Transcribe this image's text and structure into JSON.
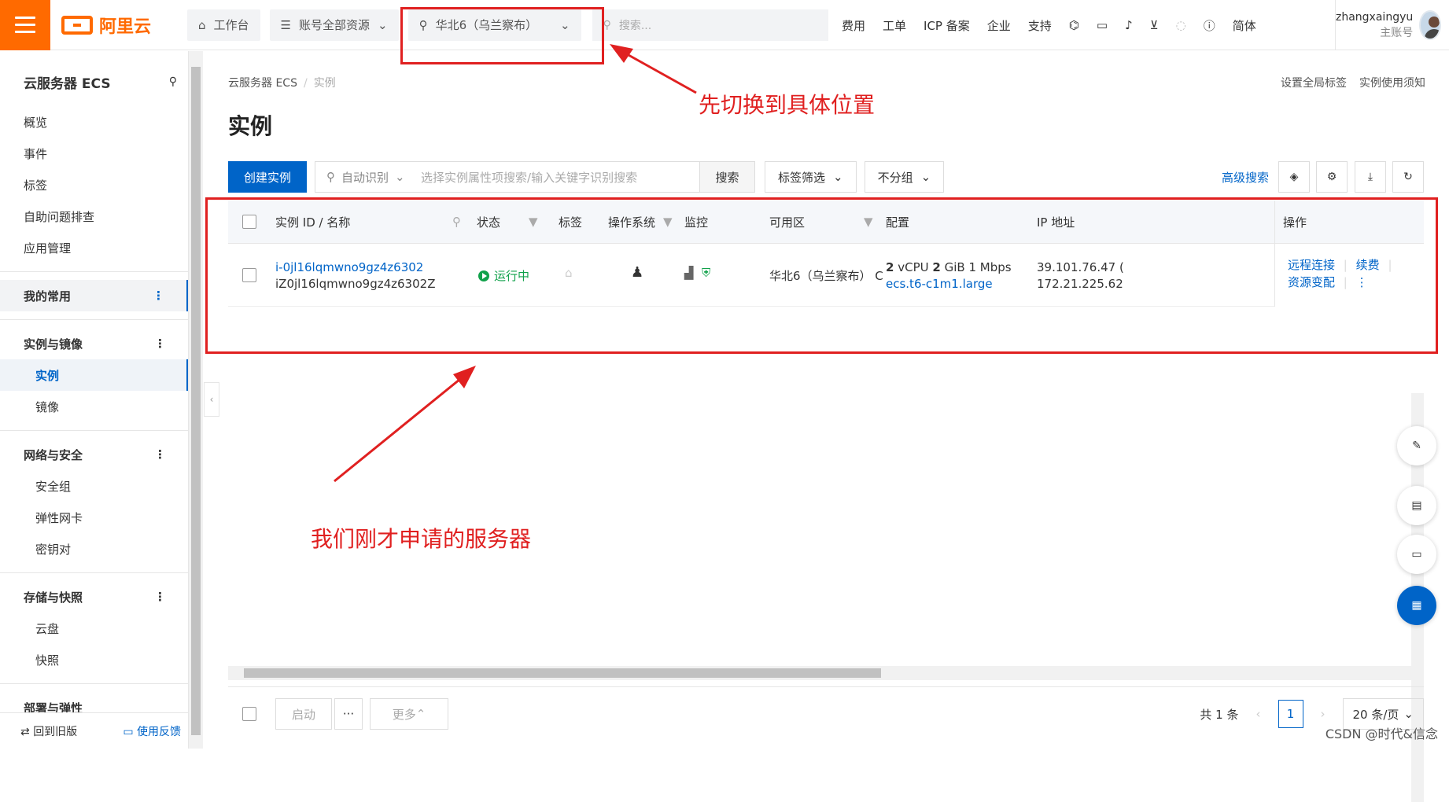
{
  "topbar": {
    "brand": "阿里云",
    "workbench": "工作台",
    "resources": "账号全部资源",
    "region": "华北6（乌兰察布）",
    "search_placeholder": "搜索...",
    "links": [
      "费用",
      "工单",
      "ICP 备案",
      "企业",
      "支持"
    ],
    "lang": "简体",
    "username": "zhangxaingyu",
    "account_type": "主账号"
  },
  "sidebar": {
    "title": "云服务器 ECS",
    "items": [
      "概览",
      "事件",
      "标签",
      "自助问题排查",
      "应用管理"
    ],
    "groups": {
      "favorites": "我的常用",
      "instances_images": "实例与镜像",
      "instance": "实例",
      "image": "镜像",
      "network": "网络与安全",
      "security_group": "安全组",
      "eni": "弹性网卡",
      "keypair": "密钥对",
      "storage": "存储与快照",
      "disk": "云盘",
      "snapshot": "快照",
      "deploy": "部署与弹性"
    },
    "footer_old": "回到旧版",
    "footer_feedback": "使用反馈"
  },
  "main": {
    "breadcrumb": [
      "云服务器 ECS",
      "实例"
    ],
    "breadcrumb_sep": "/",
    "top_links": [
      "设置全局标签",
      "实例使用须知"
    ],
    "title": "实例",
    "create_button": "创建实例",
    "auto_detect": "自动识别",
    "search_placeholder": "选择实例属性项搜索/输入关键字识别搜索",
    "search_button": "搜索",
    "tag_filter": "标签筛选",
    "no_group": "不分组",
    "advanced_search": "高级搜索"
  },
  "table": {
    "headers": [
      "实例 ID / 名称",
      "状态",
      "标签",
      "操作系统",
      "监控",
      "可用区",
      "配置",
      "IP 地址",
      "操作"
    ],
    "row": {
      "id": "i-0jl16lqmwno9gz4z6302",
      "name": "iZ0jl16lqmwno9gz4z6302Z",
      "status": "运行中",
      "zone": "华北6（乌兰察布） C",
      "config_vcpu_num": "2",
      "config_vcpu_unit": "vCPU",
      "config_mem_num": "2",
      "config_mem_unit": "GiB 1 Mbps",
      "instance_type": "ecs.t6-c1m1.large",
      "ip_public": "39.101.76.47 (",
      "ip_private": "172.21.225.62",
      "actions": [
        "远程连接",
        "续费",
        "资源变配"
      ]
    }
  },
  "footer": {
    "start": "启动",
    "more_dots": "···",
    "more": "更多",
    "total": "共 1 条",
    "page": "1",
    "page_size": "20 条/页"
  },
  "annotations": {
    "switch_location": "先切换到具体位置",
    "our_server": "我们刚才申请的服务器"
  },
  "watermark": "CSDN @时代&信念",
  "colors": {
    "brand": "#ff6a00",
    "primary": "#0064c8",
    "running": "#10a14a",
    "annotation": "#e02020"
  }
}
